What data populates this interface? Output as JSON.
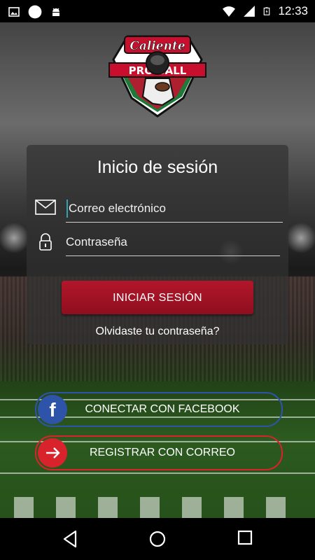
{
  "status_bar": {
    "time": "12:33",
    "left_icons": [
      "image-icon",
      "circle-icon",
      "android-icon"
    ],
    "right_icons": [
      "wifi-icon",
      "signal-icon",
      "battery-icon"
    ]
  },
  "logo": {
    "brand": "Caliente",
    "product": "PRO BALL"
  },
  "login": {
    "title": "Inicio de sesión",
    "email_placeholder": "Correo electrónico",
    "password_placeholder": "Contraseña",
    "login_button": "INICIAR SESIÓN",
    "forgot_link": "Olvidaste tu contraseña?"
  },
  "social": {
    "facebook_label": "CONECTAR CON FACEBOOK",
    "email_label": "REGISTRAR CON CORREO"
  },
  "colors": {
    "accent_red": "#b3162a",
    "facebook_blue": "#2d54a8",
    "email_red": "#d8222c"
  },
  "navigation": {
    "buttons": [
      "back-icon",
      "home-icon",
      "recents-icon"
    ]
  }
}
